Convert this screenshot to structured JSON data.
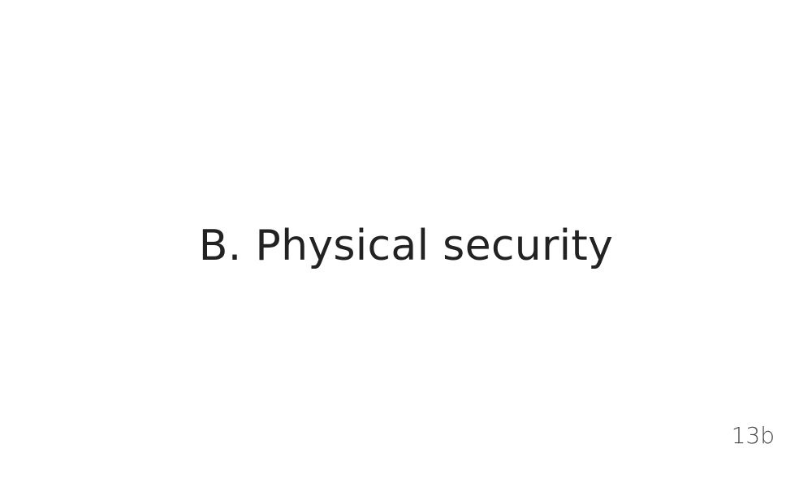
{
  "slide": {
    "title": "B. Physical security",
    "page_number": "13b"
  }
}
